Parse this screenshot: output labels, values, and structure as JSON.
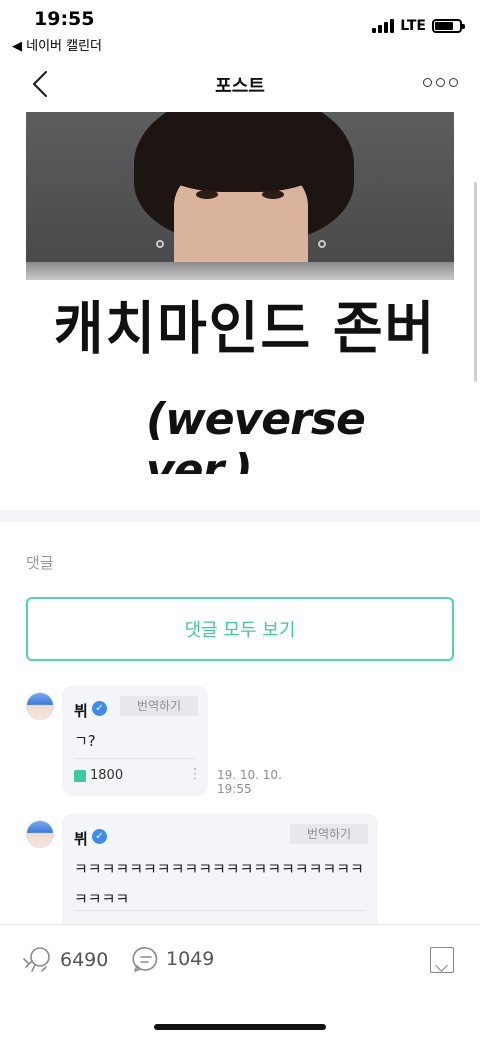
{
  "status_bar": {
    "time": "19:55",
    "back_app": "◀ 네이버 캘린더",
    "network": "LTE",
    "battery_level": 0.75
  },
  "nav": {
    "title": "포스트",
    "back_icon": "chevron-left-icon",
    "more_icon": "more-icon"
  },
  "post_image": {
    "text_line1": "캐치마인드 존버",
    "text_line2": "(weverse ver.)"
  },
  "comments": {
    "header": "댓글",
    "view_all_label": "댓글 모두 보기",
    "items": [
      {
        "author": "뷔",
        "translate_label": "번역하기",
        "text": "ㄱ?",
        "likes": "1800",
        "date": "19. 10. 10.",
        "time": "19:55"
      },
      {
        "author": "뷔",
        "translate_label": "번역하기",
        "text_line1": "ㅋㅋㅋㅋㅋㅋㅋㅋㅋㅋㅋㅋㅋㅋㅋㅋㅋㅋㅋㅋㅋ",
        "text_line2": "ㅋㅋㅋㅋ"
      }
    ]
  },
  "bottom_bar": {
    "likes_count": "6490",
    "comments_count": "1049"
  },
  "colors": {
    "accent": "#3fc8a4",
    "verified": "#3f8cf0"
  }
}
